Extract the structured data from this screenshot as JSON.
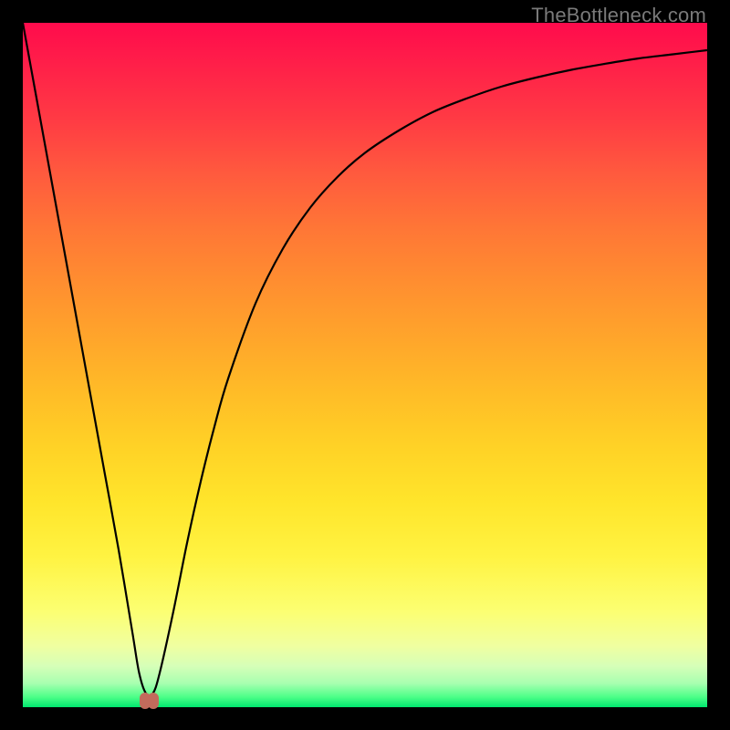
{
  "attribution": "TheBottleneck.com",
  "chart_data": {
    "type": "line",
    "title": "",
    "xlabel": "",
    "ylabel": "",
    "xlim": [
      0,
      100
    ],
    "ylim": [
      0,
      100
    ],
    "grid": false,
    "series": [
      {
        "name": "bottleneck-curve",
        "x": [
          0,
          2,
          4,
          6,
          8,
          10,
          12,
          14,
          16,
          17,
          18,
          19,
          20,
          22,
          24,
          26,
          28,
          30,
          34,
          38,
          42,
          46,
          50,
          55,
          60,
          65,
          70,
          75,
          80,
          85,
          90,
          95,
          100
        ],
        "values": [
          100,
          89,
          78,
          67,
          56,
          45,
          34,
          23,
          11,
          5,
          2,
          2,
          5,
          14,
          24,
          33,
          41,
          48,
          59,
          67,
          73,
          77.5,
          81,
          84.3,
          87,
          89,
          90.7,
          92,
          93.1,
          94,
          94.8,
          95.4,
          96
        ]
      }
    ],
    "marker": {
      "x": 18.5,
      "y": 1,
      "shape": "double-lobe",
      "color": "#c26b5c"
    },
    "background_gradient": {
      "top": "#ff0b4c",
      "upper_mid": "#ff8e30",
      "mid": "#ffe52b",
      "lower_mid": "#fcff72",
      "bottom": "#00e66e"
    }
  }
}
